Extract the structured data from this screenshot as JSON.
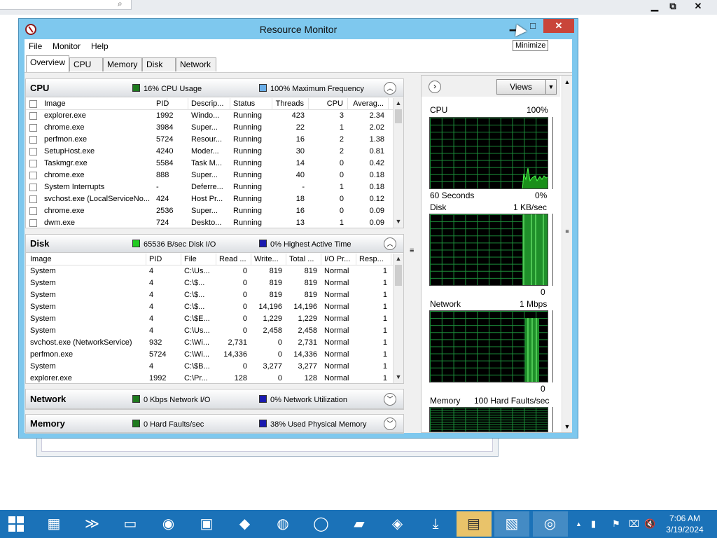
{
  "window": {
    "title": "Resource Monitor",
    "tooltip": "Minimize",
    "min_glyph": "▁",
    "max_glyph": "□",
    "close_glyph": "✕"
  },
  "topbar": {
    "min_glyph": "▁",
    "restore_glyph": "⧉",
    "close_glyph": "✕"
  },
  "menu": [
    "File",
    "Monitor",
    "Help"
  ],
  "tabs": [
    "Overview",
    "CPU",
    "Memory",
    "Disk",
    "Network"
  ],
  "cpu": {
    "title": "CPU",
    "usage_label": "16% CPU Usage",
    "freq_label": "100% Maximum Frequency",
    "usage_color": "#1e7a1e",
    "freq_color": "#6aaee8",
    "columns": [
      "Image",
      "PID",
      "Descrip...",
      "Status",
      "Threads",
      "CPU",
      "Averag..."
    ],
    "rows": [
      [
        "explorer.exe",
        "1992",
        "Windo...",
        "Running",
        "423",
        "3",
        "2.34"
      ],
      [
        "chrome.exe",
        "3984",
        "Super...",
        "Running",
        "22",
        "1",
        "2.02"
      ],
      [
        "perfmon.exe",
        "5724",
        "Resour...",
        "Running",
        "16",
        "2",
        "1.38"
      ],
      [
        "SetupHost.exe",
        "4240",
        "Moder...",
        "Running",
        "30",
        "2",
        "0.81"
      ],
      [
        "Taskmgr.exe",
        "5584",
        "Task M...",
        "Running",
        "14",
        "0",
        "0.42"
      ],
      [
        "chrome.exe",
        "888",
        "Super...",
        "Running",
        "40",
        "0",
        "0.18"
      ],
      [
        "System Interrupts",
        "-",
        "Deferre...",
        "Running",
        "-",
        "1",
        "0.18"
      ],
      [
        "svchost.exe (LocalServiceNo...",
        "424",
        "Host Pr...",
        "Running",
        "18",
        "0",
        "0.12"
      ],
      [
        "chrome.exe",
        "2536",
        "Super...",
        "Running",
        "16",
        "0",
        "0.09"
      ],
      [
        "dwm.exe",
        "724",
        "Deskto...",
        "Running",
        "13",
        "1",
        "0.09"
      ]
    ]
  },
  "disk": {
    "title": "Disk",
    "io_label": "65536 B/sec Disk I/O",
    "active_label": "0% Highest Active Time",
    "io_color": "#22cc22",
    "active_color": "#1a1ab0",
    "columns": [
      "Image",
      "PID",
      "File",
      "Read ...",
      "Write...",
      "Total ...",
      "I/O Pr...",
      "Resp..."
    ],
    "rows": [
      [
        "System",
        "4",
        "C:\\Us...",
        "0",
        "819",
        "819",
        "Normal",
        "1"
      ],
      [
        "System",
        "4",
        "C:\\$...",
        "0",
        "819",
        "819",
        "Normal",
        "1"
      ],
      [
        "System",
        "4",
        "C:\\$...",
        "0",
        "819",
        "819",
        "Normal",
        "1"
      ],
      [
        "System",
        "4",
        "C:\\$...",
        "0",
        "14,196",
        "14,196",
        "Normal",
        "1"
      ],
      [
        "System",
        "4",
        "C:\\$E...",
        "0",
        "1,229",
        "1,229",
        "Normal",
        "1"
      ],
      [
        "System",
        "4",
        "C:\\Us...",
        "0",
        "2,458",
        "2,458",
        "Normal",
        "1"
      ],
      [
        "svchost.exe (NetworkService)",
        "932",
        "C:\\Wi...",
        "2,731",
        "0",
        "2,731",
        "Normal",
        "1"
      ],
      [
        "perfmon.exe",
        "5724",
        "C:\\Wi...",
        "14,336",
        "0",
        "14,336",
        "Normal",
        "1"
      ],
      [
        "System",
        "4",
        "C:\\$B...",
        "0",
        "3,277",
        "3,277",
        "Normal",
        "1"
      ],
      [
        "explorer.exe",
        "1992",
        "C:\\Pr...",
        "128",
        "0",
        "128",
        "Normal",
        "1"
      ]
    ]
  },
  "network": {
    "title": "Network",
    "io_label": "0 Kbps Network I/O",
    "util_label": "0% Network Utilization",
    "io_color": "#1e7a1e",
    "util_color": "#1a1ab0"
  },
  "memory": {
    "title": "Memory",
    "faults_label": "0 Hard Faults/sec",
    "used_label": "38% Used Physical Memory",
    "faults_color": "#1e7a1e",
    "used_color": "#1a1ab0"
  },
  "right": {
    "views_label": "Views",
    "cpu_graph": {
      "title": "CPU",
      "max": "100%",
      "footer_left": "60 Seconds",
      "footer_right": "0%"
    },
    "disk_graph": {
      "title": "Disk",
      "max": "1 KB/sec",
      "footer_right": "0"
    },
    "network_graph": {
      "title": "Network",
      "max": "1 Mbps",
      "footer_right": "0"
    },
    "memory_graph": {
      "title": "Memory",
      "max": "100 Hard Faults/sec"
    }
  },
  "taskbar": {
    "apps": [
      "server-manager-icon",
      "powershell-icon",
      "file-explorer-icon",
      "browser-globe-icon",
      "network-computer-icon",
      "toolbox-icon",
      "firefox-icon",
      "opera-icon",
      "notepad-icon",
      "media-player-icon",
      "download-icon",
      "drive-icon",
      "performance-icon",
      "resource-monitor-icon"
    ],
    "time": "7:06 AM",
    "date": "3/19/2024"
  }
}
